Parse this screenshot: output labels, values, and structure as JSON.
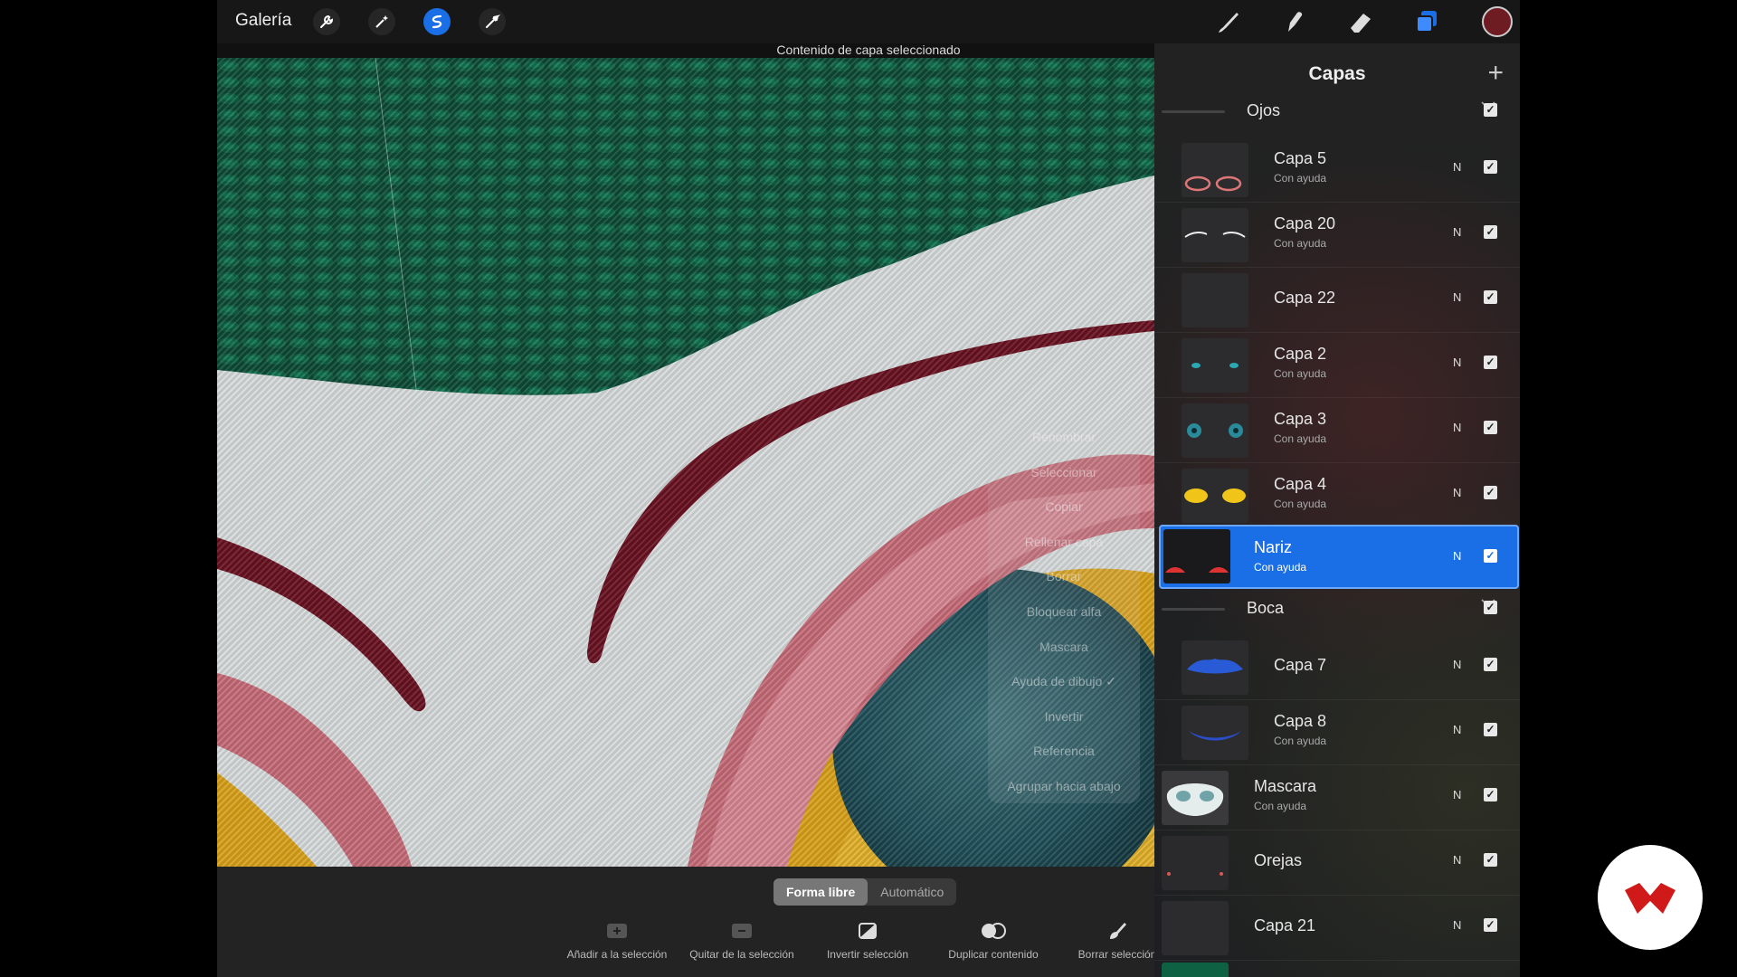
{
  "topbar": {
    "gallery": "Galería",
    "status": "Contenido de capa seleccionado",
    "color": "#6e1b22"
  },
  "context_menu": [
    "Renombrar",
    "Seleccionar",
    "Copiar",
    "Rellenar capa",
    "Borrar",
    "Bloquear alfa",
    "Mascara",
    "Ayuda de dibujo ✓",
    "Invertir",
    "Referencia",
    "Agrupar hacia abajo"
  ],
  "selection_bar": {
    "mode_freeform": "Forma libre",
    "mode_auto": "Automático",
    "actions": [
      "Añadir a la selección",
      "Quitar de la selección",
      "Invertir selección",
      "Duplicar contenido",
      "Borrar selección"
    ]
  },
  "layers": {
    "title": "Capas",
    "items": [
      {
        "kind": "group",
        "name": "Ojos"
      },
      {
        "kind": "layer",
        "name": "Capa 5",
        "sub": "Con ayuda",
        "mode": "N"
      },
      {
        "kind": "layer",
        "name": "Capa 20",
        "sub": "Con ayuda",
        "mode": "N"
      },
      {
        "kind": "layer",
        "name": "Capa 22",
        "sub": "",
        "mode": "N"
      },
      {
        "kind": "layer",
        "name": "Capa 2",
        "sub": "Con ayuda",
        "mode": "N"
      },
      {
        "kind": "layer",
        "name": "Capa 3",
        "sub": "Con ayuda",
        "mode": "N"
      },
      {
        "kind": "layer",
        "name": "Capa 4",
        "sub": "Con ayuda",
        "mode": "N"
      },
      {
        "kind": "layer",
        "name": "Nariz",
        "sub": "Con ayuda",
        "mode": "N",
        "selected": true
      },
      {
        "kind": "group",
        "name": "Boca"
      },
      {
        "kind": "layer",
        "name": "Capa 7",
        "sub": "",
        "mode": "N"
      },
      {
        "kind": "layer",
        "name": "Capa 8",
        "sub": "Con ayuda",
        "mode": "N"
      },
      {
        "kind": "layer",
        "name": "Mascara",
        "sub": "Con ayuda",
        "mode": "N"
      },
      {
        "kind": "layer",
        "name": "Orejas",
        "sub": "",
        "mode": "N"
      },
      {
        "kind": "layer",
        "name": "Capa 21",
        "sub": "",
        "mode": "N"
      }
    ]
  }
}
